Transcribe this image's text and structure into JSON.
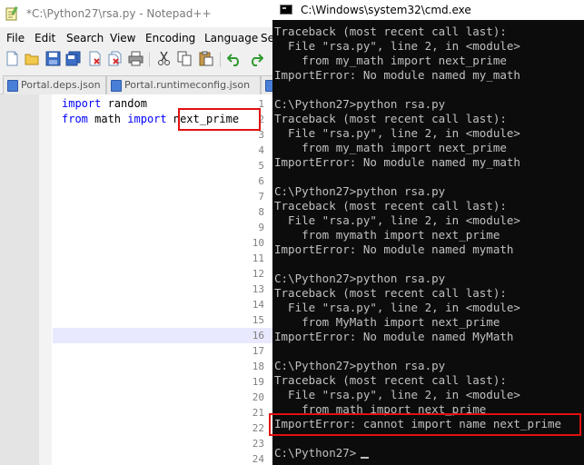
{
  "notepad": {
    "title": "*C:\\Python27\\rsa.py - Notepad++",
    "menu": [
      "File",
      "Edit",
      "Search",
      "View",
      "Encoding",
      "Language",
      "Se"
    ],
    "tabs": [
      "Portal.deps.json",
      "Portal.runtimeconfig.json",
      "w"
    ],
    "toolbar_icons": [
      "new-file-icon",
      "open-file-icon",
      "save-icon",
      "save-all-icon",
      "close-icon",
      "close-all-icon",
      "print-icon",
      "cut-icon",
      "copy-icon",
      "paste-icon",
      "undo-icon",
      "redo-icon"
    ],
    "line_numbers": [
      "1",
      "2",
      "3",
      "4",
      "5",
      "6",
      "7",
      "8",
      "9",
      "10",
      "11",
      "12",
      "13",
      "14",
      "15",
      "16",
      "17",
      "18",
      "19",
      "20",
      "21",
      "22",
      "23",
      "24"
    ],
    "code": {
      "line1": {
        "kw": "import",
        "rest": " random"
      },
      "line2": {
        "kw1": "from",
        "mid": " math ",
        "kw2": "import",
        "name": "next_prime"
      }
    },
    "current_line": "16"
  },
  "cmd": {
    "title": "C:\\Windows\\system32\\cmd.exe",
    "lines": [
      "Traceback (most recent call last):",
      "  File \"rsa.py\", line 2, in <module>",
      "    from my_math import next_prime",
      "ImportError: No module named my_math",
      "",
      "C:\\Python27>python rsa.py",
      "Traceback (most recent call last):",
      "  File \"rsa.py\", line 2, in <module>",
      "    from my_math import next_prime",
      "ImportError: No module named my_math",
      "",
      "C:\\Python27>python rsa.py",
      "Traceback (most recent call last):",
      "  File \"rsa.py\", line 2, in <module>",
      "    from mymath import next_prime",
      "ImportError: No module named mymath",
      "",
      "C:\\Python27>python rsa.py",
      "Traceback (most recent call last):",
      "  File \"rsa.py\", line 2, in <module>",
      "    from MyMath import next_prime",
      "ImportError: No module named MyMath",
      "",
      "C:\\Python27>python rsa.py",
      "Traceback (most recent call last):",
      "  File \"rsa.py\", line 2, in <module>",
      "    from math import next_prime",
      "ImportError: cannot import name next_prime",
      "",
      "C:\\Python27>"
    ]
  },
  "colors": {
    "highlight_box": "#e01010",
    "keyword": "#0000ff",
    "console_bg": "#0c0c0c",
    "console_fg": "#c0c0c0"
  }
}
